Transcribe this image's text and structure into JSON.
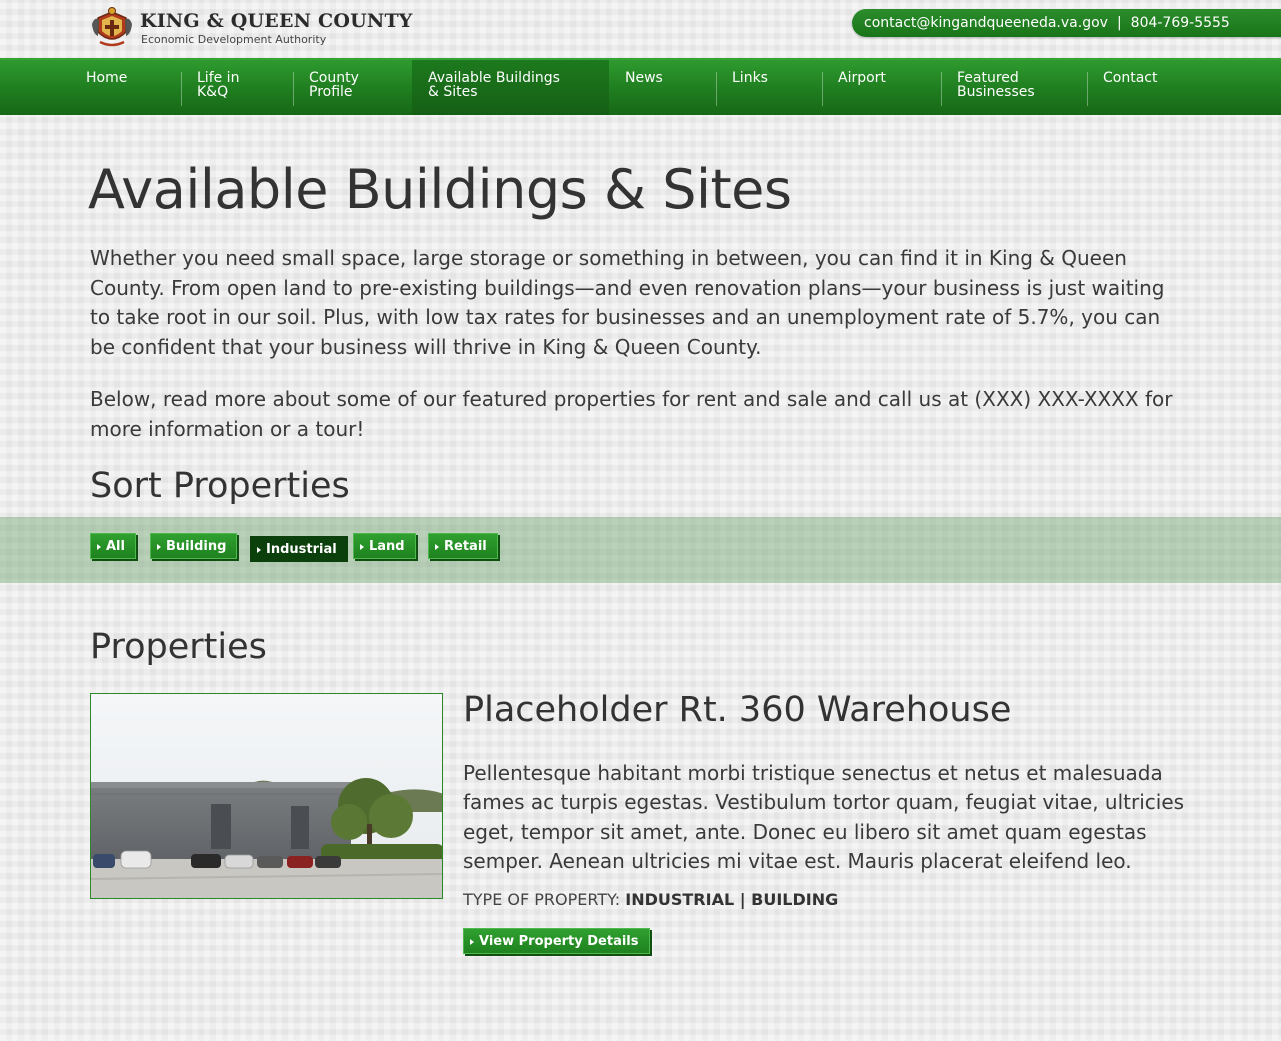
{
  "header": {
    "logo_title": "KING & QUEEN COUNTY",
    "logo_subtitle": "Economic Development Authority",
    "email": "contact@kingandqueeneda.va.gov",
    "separator": "|",
    "phone": "804-769-5555"
  },
  "nav": {
    "items": [
      {
        "line1": "Home",
        "line2": ""
      },
      {
        "line1": "Life in",
        "line2": "K&Q"
      },
      {
        "line1": "County",
        "line2": "Profile"
      },
      {
        "line1": "Available Buildings",
        "line2": "& Sites"
      },
      {
        "line1": "News",
        "line2": ""
      },
      {
        "line1": "Links",
        "line2": ""
      },
      {
        "line1": "Airport",
        "line2": ""
      },
      {
        "line1": "Featured",
        "line2": "Businesses"
      },
      {
        "line1": "Contact",
        "line2": ""
      }
    ],
    "active": "Available Buildings & Sites"
  },
  "main": {
    "title": "Available Buildings & Sites",
    "intro": "Whether you need small space, large storage or something in between, you can find it in King & Queen County. From open land to pre-existing buildings—and even renovation plans—your business is just waiting to take root in our soil. Plus, with low tax rates for businesses and an unemployment rate of 5.7%, you can be confident that your business will thrive in King & Queen County.",
    "intro2": "Below, read more about some of our featured properties for rent and sale and call us at (XXX) XXX-XXXX for more information or a tour!",
    "sort_title": "Sort Properties",
    "filters": [
      "All",
      "Building",
      "Industrial",
      "Land",
      "Retail"
    ],
    "selected_filter": "Industrial",
    "properties_title": "Properties"
  },
  "property": {
    "name": "Placeholder Rt. 360 Warehouse",
    "description": "Pellentesque habitant morbi tristique senectus et netus et malesuada fames ac turpis egestas. Vestibulum tortor quam, feugiat vitae, ultricies eget, tempor sit amet, ante. Donec eu libero sit amet quam egestas semper. Aenean ultricies mi vitae est. Mauris placerat eleifend leo.",
    "type_label": "TYPE OF PROPERTY:",
    "type_value": "INDUSTRIAL | BUILDING",
    "button_label": "View Property Details"
  },
  "colors": {
    "brand_green": "#1f821f",
    "selected_filter": "#0b3f0b",
    "filter_band": "#a9c2a9"
  }
}
